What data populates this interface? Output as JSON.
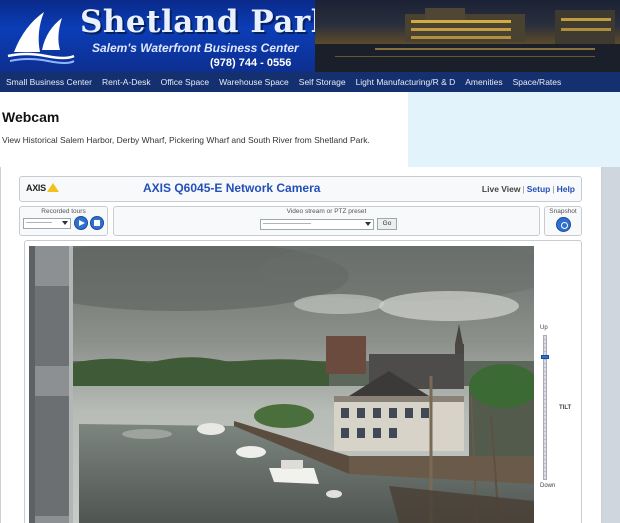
{
  "header": {
    "logo_title": "Shetland Park",
    "logo_subtitle": "Salem's Waterfront Business Center",
    "phone": "(978) 744 - 0556"
  },
  "nav": {
    "items": [
      {
        "label": "Small Business Center"
      },
      {
        "label": "Rent-A-Desk"
      },
      {
        "label": "Office Space"
      },
      {
        "label": "Warehouse Space"
      },
      {
        "label": "Self Storage"
      },
      {
        "label": "Light Manufacturing/R & D"
      },
      {
        "label": "Amenities"
      },
      {
        "label": "Space/Rates"
      }
    ]
  },
  "page": {
    "title": "Webcam",
    "description": "View Historical Salem Harbor, Derby Wharf, Pickering Wharf and South River from Shetland Park."
  },
  "camera": {
    "brand": "AXIS",
    "title": "AXIS Q6045-E Network Camera",
    "links": {
      "live_view": "Live View",
      "setup": "Setup",
      "help": "Help"
    },
    "recorded_tours": {
      "label": "Recorded tours",
      "selected": "-------------"
    },
    "video_stream": {
      "label": "Video stream or PTZ preset",
      "selected": "------------------------",
      "go_label": "Go"
    },
    "snapshot": {
      "label": "Snapshot"
    },
    "tilt": {
      "up_label": "Up",
      "down_label": "Down",
      "axis_label": "TILT",
      "level": 0.15
    }
  },
  "colors": {
    "banner": "#0b3db7",
    "nav": "#14306f",
    "accent_link": "#2350b8",
    "button": "#2f6fd0"
  }
}
